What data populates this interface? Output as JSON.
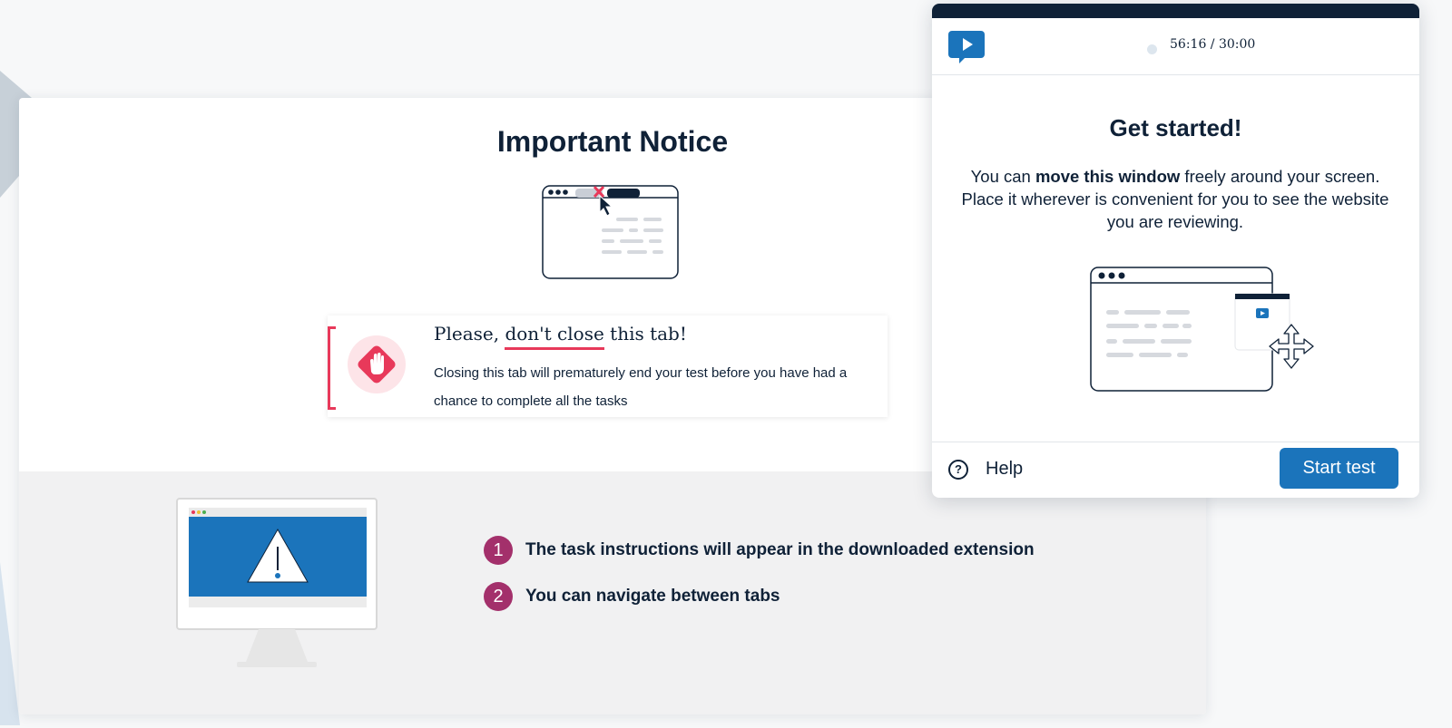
{
  "notice": {
    "title": "Important Notice",
    "warning": {
      "title_prefix": "Please, ",
      "title_emphasis": "don't close",
      "title_suffix": " this tab!",
      "text": "Closing this tab will prematurely end your test before you have had a chance to complete all the tasks"
    },
    "steps": [
      {
        "number": "1",
        "text": "The task instructions will appear in the downloaded extension"
      },
      {
        "number": "2",
        "text": "You can navigate between tabs"
      }
    ]
  },
  "popup": {
    "timer": "56:16 / 30:00",
    "heading": "Get started!",
    "body": {
      "prefix": "You can ",
      "bold": "move this window",
      "suffix": " freely around your screen. Place it wherever is convenient for you to see the website you are reviewing."
    },
    "help_label": "Help",
    "start_button_label": "Start test"
  },
  "icons": {
    "logo": "play-chat-icon",
    "help": "question-circle-icon",
    "stop": "stop-hand-icon",
    "warning": "warning-triangle-icon",
    "move": "move-arrows-icon"
  },
  "colors": {
    "primary_blue": "#1b74bb",
    "navy": "#0f2137",
    "alert_red": "#e8395a",
    "step_purple": "#a3306b"
  }
}
